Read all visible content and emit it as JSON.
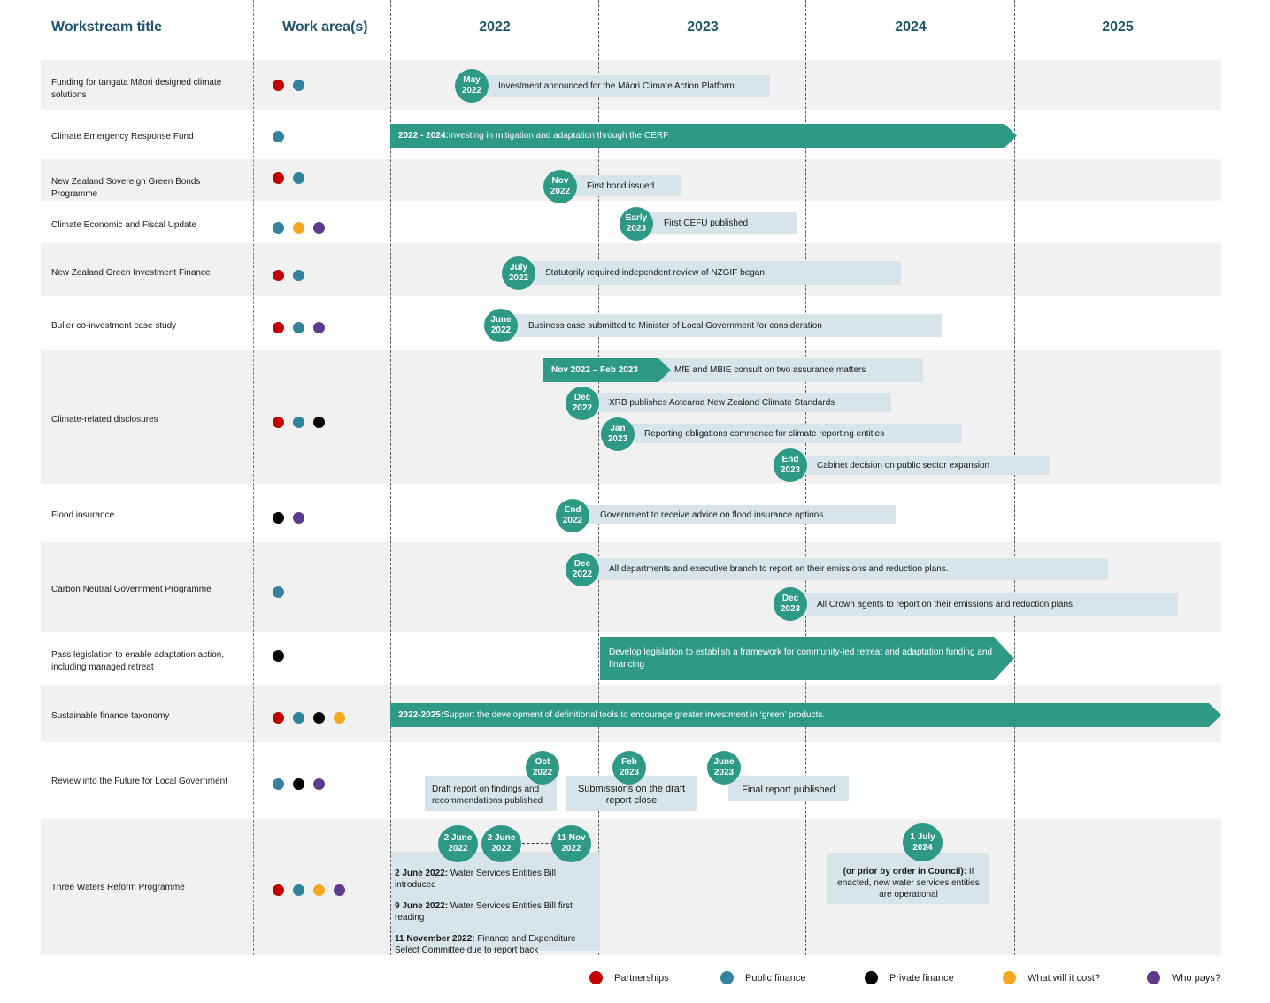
{
  "header": {
    "workstream_title": "Workstream title",
    "work_areas": "Work area(s)",
    "years": [
      "2022",
      "2023",
      "2024",
      "2025"
    ]
  },
  "colors": {
    "partnerships": "#c00000",
    "public_finance": "#31849b",
    "private_finance": "#000000",
    "what_will_it_cost": "#f6a81c",
    "who_pays": "#5d3a8e",
    "accent_teal": "#2e9985",
    "bar_fill": "#d7e5ea",
    "header_text": "#1f5470"
  },
  "rows": [
    {
      "title": "Funding for tangata Māori designed climate solutions",
      "areas": [
        "partnerships",
        "public_finance"
      ]
    },
    {
      "title": "Climate Emergency Response Fund",
      "areas": [
        "public_finance"
      ]
    },
    {
      "title": "New Zealand Sovereign Green Bonds Programme",
      "areas": [
        "partnerships",
        "public_finance"
      ]
    },
    {
      "title": "Climate Economic and Fiscal Update",
      "areas": [
        "public_finance",
        "what_will_it_cost",
        "who_pays"
      ]
    },
    {
      "title": "New Zealand Green Investment Finance",
      "areas": [
        "partnerships",
        "public_finance"
      ]
    },
    {
      "title": "Buller co-investment case study",
      "areas": [
        "partnerships",
        "public_finance",
        "who_pays"
      ]
    },
    {
      "title": "Climate-related disclosures",
      "areas": [
        "partnerships",
        "public_finance",
        "private_finance"
      ]
    },
    {
      "title": "Flood insurance",
      "areas": [
        "private_finance",
        "who_pays"
      ]
    },
    {
      "title": "Carbon Neutral Government Programme",
      "areas": [
        "public_finance"
      ]
    },
    {
      "title": "Pass legislation to enable adaptation action, including managed retreat",
      "areas": [
        "private_finance"
      ]
    },
    {
      "title": "Sustainable finance taxonomy",
      "areas": [
        "partnerships",
        "public_finance",
        "private_finance",
        "what_will_it_cost"
      ]
    },
    {
      "title": "Review into the Future for Local Government",
      "areas": [
        "public_finance",
        "private_finance",
        "who_pays"
      ]
    },
    {
      "title": "Three Waters Reform Programme",
      "areas": [
        "partnerships",
        "public_finance",
        "what_will_it_cost",
        "who_pays"
      ]
    }
  ],
  "milestones": {
    "m1": {
      "date1": "May",
      "date2": "2022",
      "text": "Investment announced for the Māori Climate Action Platform"
    },
    "cerf": {
      "bold": "2022 - 2024:",
      "text": " Investing in mitigation and adaptation through the CERF"
    },
    "m3": {
      "date1": "Nov",
      "date2": "2022",
      "text": "First bond issued"
    },
    "m4": {
      "date1": "Early",
      "date2": "2023",
      "text": "First CEFU published"
    },
    "m5": {
      "date1": "July",
      "date2": "2022",
      "text": "Statutorily required independent review of NZGIF began"
    },
    "m6": {
      "date1": "June",
      "date2": "2022",
      "text": "Business case submitted to Minister of Local Government for consideration"
    },
    "m7a": {
      "range": "Nov 2022 – Feb 2023",
      "text": "MfE and MBIE consult on two assurance matters"
    },
    "m7b": {
      "date1": "Dec",
      "date2": "2022",
      "text": "XRB publishes Aotearoa New Zealand Climate Standards"
    },
    "m7c": {
      "date1": "Jan",
      "date2": "2023",
      "text": "Reporting obligations commence for climate reporting entities"
    },
    "m7d": {
      "date1": "End",
      "date2": "2023",
      "text": "Cabinet decision on public sector expansion"
    },
    "m8": {
      "date1": "End",
      "date2": "2022",
      "text": "Government to receive advice on flood insurance options"
    },
    "m9a": {
      "date1": "Dec",
      "date2": "2022",
      "text": "All departments and executive branch to report on their emissions and reduction plans."
    },
    "m9b": {
      "date1": "Dec",
      "date2": "2023",
      "text": "All Crown agents to report on their emissions and reduction plans."
    },
    "m10": {
      "text": "Develop legislation to establish a framework for community-led retreat and adaptation funding and financing"
    },
    "m11": {
      "bold": "2022-2025:",
      "text": " Support the development of definitional tools to encourage greater investment in ‘green’ products."
    },
    "m12a": {
      "date1": "Oct",
      "date2": "2022",
      "text": "Draft report on findings and recommendations published"
    },
    "m12b": {
      "date1": "Feb",
      "date2": "2023",
      "text": "Submissions on the draft report close"
    },
    "m12c": {
      "date1": "June",
      "date2": "2023",
      "text": "Final report published"
    },
    "m13": {
      "c1": {
        "date1": "2 June",
        "date2": "2022"
      },
      "c2": {
        "date1": "2 June",
        "date2": "2022"
      },
      "c3": {
        "date1": "11 Nov",
        "date2": "2022"
      },
      "lines": [
        {
          "bold": "2 June 2022:",
          "text": " Water Services Entities Bill introduced"
        },
        {
          "bold": "9 June 2022:",
          "text": " Water Services Entities Bill first reading"
        },
        {
          "bold": "11 November 2022:",
          "text": " Finance and Expenditure Select Committee due to report back"
        }
      ],
      "c4": {
        "date1": "1 July",
        "date2": "2024"
      },
      "c4_bold": "(or prior by order in Council):",
      "c4_text": " If enacted, new water services entities are operational"
    }
  },
  "legend": [
    {
      "key": "partnerships",
      "label": "Partnerships"
    },
    {
      "key": "public_finance",
      "label": "Public finance"
    },
    {
      "key": "private_finance",
      "label": "Private finance"
    },
    {
      "key": "what_will_it_cost",
      "label": "What will it cost?"
    },
    {
      "key": "who_pays",
      "label": "Who pays?"
    }
  ]
}
